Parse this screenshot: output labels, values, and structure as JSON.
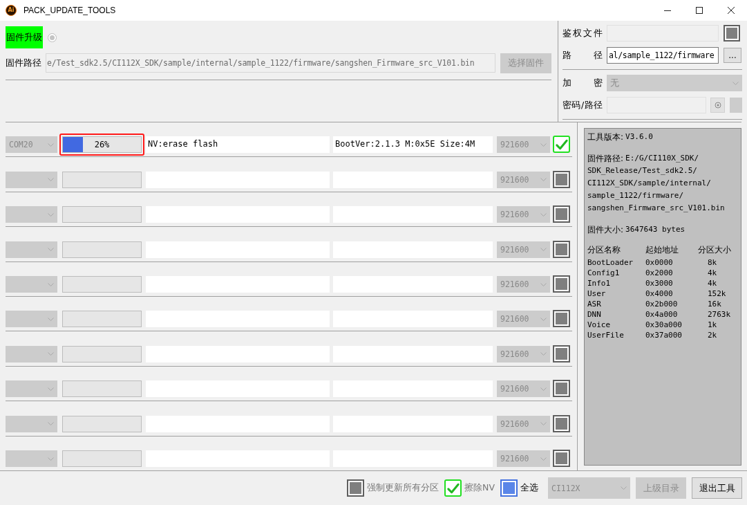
{
  "window": {
    "title": "PACK_UPDATE_TOOLS",
    "icon_text": "Ai"
  },
  "upgrade": {
    "mode_label": "固件升级",
    "mode_selected": true,
    "path_label": "固件路径",
    "path_value": "e/Test_sdk2.5/CI112X_SDK/sample/internal/sample_1122/firmware/sangshen_Firmware_src_V101.bin",
    "select_button": {
      "label": "选择固件",
      "disabled": true
    }
  },
  "auth": {
    "auth_file_label": "鉴权文件",
    "path_label": "路径",
    "path_value": "al/sample_1122/firmware",
    "browse_button": "...",
    "encrypt_label": "加密",
    "encrypt_value": "无",
    "password_label": "密码/路径"
  },
  "ports": [
    {
      "port": "COM20",
      "level": 0.26,
      "percent": "26%",
      "highlighted": true,
      "status": "NV:erase flash",
      "info": "BootVer:2.1.3 M:0x5E Size:4M",
      "baud": "921600",
      "checked": true
    },
    {
      "level": 0,
      "highlighted": false,
      "baud": "921600",
      "checked": false
    },
    {
      "level": 0,
      "highlighted": false,
      "baud": "921600",
      "checked": false
    },
    {
      "level": 0,
      "highlighted": false,
      "baud": "921600",
      "checked": false
    },
    {
      "level": 0,
      "highlighted": false,
      "baud": "921600",
      "checked": false
    },
    {
      "level": 0,
      "highlighted": false,
      "baud": "921600",
      "checked": false
    },
    {
      "level": 0,
      "highlighted": false,
      "baud": "921600",
      "checked": false
    },
    {
      "level": 0,
      "highlighted": false,
      "baud": "921600",
      "checked": false
    },
    {
      "level": 0,
      "highlighted": false,
      "baud": "921600",
      "checked": false
    },
    {
      "level": 0,
      "highlighted": false,
      "baud": "921600",
      "checked": false
    }
  ],
  "info_panel": {
    "version_label": "工具版本:",
    "version": "V3.6.0",
    "path_label": "固件路径:",
    "path_lines": [
      "E:/G/CI110X_SDK/",
      "SDK_Release/Test_sdk2.5/",
      "CI112X_SDK/sample/internal/",
      "sample_1122/firmware/",
      "sangshen_Firmware_src_V101.bin"
    ],
    "size_label": "固件大小:",
    "size": "3647643 bytes",
    "partition_columns": [
      "分区名称",
      "起始地址",
      "分区大小"
    ],
    "partitions": [
      {
        "name": "BootLoader",
        "start": "0x0000",
        "size": "8k"
      },
      {
        "name": "Config1",
        "start": "0x2000",
        "size": "4k"
      },
      {
        "name": "Info1",
        "start": "0x3000",
        "size": "4k"
      },
      {
        "name": "User",
        "start": "0x4000",
        "size": "152k"
      },
      {
        "name": "ASR",
        "start": "0x2b000",
        "size": "16k"
      },
      {
        "name": "DNN",
        "start": "0x4a000",
        "size": "2763k"
      },
      {
        "name": "Voice",
        "start": "0x30a000",
        "size": "1k"
      },
      {
        "name": "UserFile",
        "start": "0x37a000",
        "size": "2k"
      }
    ]
  },
  "bottom_bar": {
    "options": [
      {
        "label": "强制更新所有分区",
        "kind": "tick",
        "checked": false,
        "disabled": true
      },
      {
        "label": "擦除NV",
        "kind": "tick",
        "checked": true,
        "disabled": true
      },
      {
        "label": "全选",
        "kind": "fill",
        "checked": true,
        "disabled": false
      }
    ],
    "chip_select": "CI112X",
    "buttons": [
      {
        "label": "上级目录",
        "disabled": true
      },
      {
        "label": "退出工具",
        "disabled": false
      }
    ]
  }
}
